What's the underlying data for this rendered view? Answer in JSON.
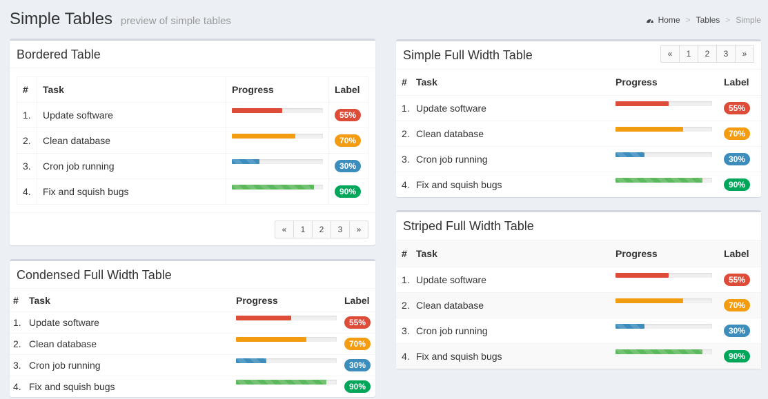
{
  "header": {
    "title": "Simple Tables",
    "subtitle": "preview of simple tables",
    "breadcrumb": {
      "home": "Home",
      "tables": "Tables",
      "active": "Simple"
    }
  },
  "columns": {
    "num": "#",
    "task": "Task",
    "progress": "Progress",
    "label": "Label"
  },
  "rows": [
    {
      "num": "1.",
      "task": "Update software",
      "progress": 0.55,
      "label": "55%",
      "color": "#dd4b39"
    },
    {
      "num": "2.",
      "task": "Clean database",
      "progress": 0.7,
      "label": "70%",
      "color": "#f39c12"
    },
    {
      "num": "3.",
      "task": "Cron job running",
      "progress": 0.3,
      "label": "30%",
      "color": "#3c8dbc"
    },
    {
      "num": "4.",
      "task": "Fix and squish bugs",
      "progress": 0.9,
      "label": "90%",
      "color": "#00a65a"
    }
  ],
  "boxes": {
    "bordered": {
      "title": "Bordered Table"
    },
    "condensed": {
      "title": "Condensed Full Width Table"
    },
    "simple": {
      "title": "Simple Full Width Table"
    },
    "striped": {
      "title": "Striped Full Width Table"
    }
  },
  "pagination": {
    "prev": "«",
    "p1": "1",
    "p2": "2",
    "p3": "3",
    "next": "»"
  },
  "icons": {
    "breadcrumb_home": "dashboard-icon"
  }
}
